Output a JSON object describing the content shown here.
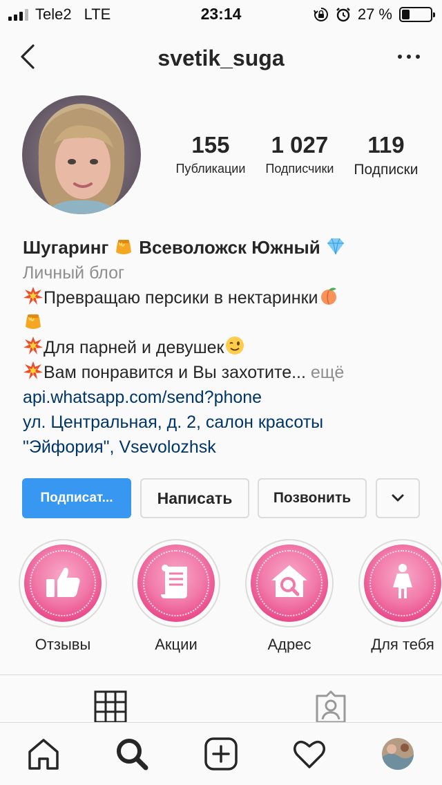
{
  "status_bar": {
    "carrier": "Tele2",
    "network": "LTE",
    "time": "23:14",
    "battery_percent": "27 %",
    "battery_level": 0.27
  },
  "header": {
    "username": "svetik_suga",
    "back_icon": "chevron-left-icon",
    "more_icon": "more-horizontal-icon"
  },
  "profile": {
    "stats": [
      {
        "value": "155",
        "label": "Публикации"
      },
      {
        "value": "1 027",
        "label": "Подписчики"
      },
      {
        "value": "119",
        "label": "Подписки"
      }
    ]
  },
  "bio": {
    "name_part1": "Шугаринг",
    "name_part2": "Всеволожск Южный",
    "category": "Личный блог",
    "line1": "Превращаю персики в нектаринки",
    "line2": "Для парней и девушек",
    "line3": "Вам понравится и Вы захотите...",
    "more": "ещё",
    "link": "api.whatsapp.com/send?phone",
    "address_line1": "ул. Центральная, д. 2, салон красоты",
    "address_line2": "\"Эйфория\", Vsevolozhsk"
  },
  "actions": {
    "follow": "Подписат...",
    "message": "Написать",
    "call": "Позвонить",
    "dropdown_icon": "chevron-down-icon"
  },
  "highlights": [
    {
      "label": "Отзывы",
      "icon": "thumbs-up-icon"
    },
    {
      "label": "Акции",
      "icon": "scroll-icon"
    },
    {
      "label": "Адрес",
      "icon": "house-search-icon"
    },
    {
      "label": "Для тебя",
      "icon": "woman-icon"
    }
  ],
  "tabs": [
    {
      "icon": "grid-icon",
      "active": true
    },
    {
      "icon": "tagged-icon",
      "active": false
    }
  ],
  "bottom_nav": [
    {
      "icon": "home-icon"
    },
    {
      "icon": "search-icon",
      "active": true
    },
    {
      "icon": "add-post-icon"
    },
    {
      "icon": "heart-icon"
    },
    {
      "icon": "profile-avatar"
    }
  ],
  "colors": {
    "accent": "#3897f0",
    "link": "#003569",
    "muted": "#8e8e8e",
    "highlight_pink": "#f17aa9"
  }
}
